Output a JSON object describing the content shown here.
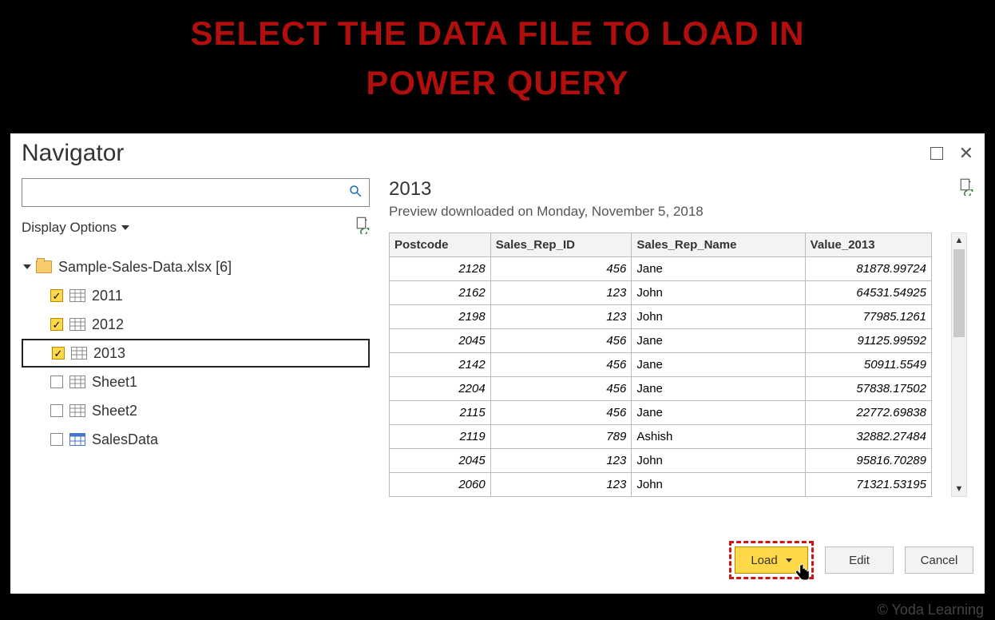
{
  "banner_line1": "SELECT THE DATA FILE TO LOAD IN",
  "banner_line2": "POWER QUERY",
  "copyright": "© Yoda Learning",
  "dialog": {
    "title": "Navigator",
    "search_placeholder": "",
    "display_options_label": "Display Options"
  },
  "tree": {
    "root_label": "Sample-Sales-Data.xlsx [6]",
    "items": [
      {
        "label": "2011",
        "checked": true,
        "selected": false,
        "icon": "sheet"
      },
      {
        "label": "2012",
        "checked": true,
        "selected": false,
        "icon": "sheet"
      },
      {
        "label": "2013",
        "checked": true,
        "selected": true,
        "icon": "sheet"
      },
      {
        "label": "Sheet1",
        "checked": false,
        "selected": false,
        "icon": "sheet"
      },
      {
        "label": "Sheet2",
        "checked": false,
        "selected": false,
        "icon": "sheet"
      },
      {
        "label": "SalesData",
        "checked": false,
        "selected": false,
        "icon": "table"
      }
    ]
  },
  "preview": {
    "title": "2013",
    "subtitle": "Preview downloaded on Monday, November 5, 2018",
    "columns": [
      "Postcode",
      "Sales_Rep_ID",
      "Sales_Rep_Name",
      "Value_2013"
    ],
    "rows": [
      [
        "2128",
        "456",
        "Jane",
        "81878.99724"
      ],
      [
        "2162",
        "123",
        "John",
        "64531.54925"
      ],
      [
        "2198",
        "123",
        "John",
        "77985.1261"
      ],
      [
        "2045",
        "456",
        "Jane",
        "91125.99592"
      ],
      [
        "2142",
        "456",
        "Jane",
        "50911.5549"
      ],
      [
        "2204",
        "456",
        "Jane",
        "57838.17502"
      ],
      [
        "2115",
        "456",
        "Jane",
        "22772.69838"
      ],
      [
        "2119",
        "789",
        "Ashish",
        "32882.27484"
      ],
      [
        "2045",
        "123",
        "John",
        "95816.70289"
      ],
      [
        "2060",
        "123",
        "John",
        "71321.53195"
      ]
    ],
    "col_align": [
      "num",
      "num",
      "txt",
      "num"
    ]
  },
  "buttons": {
    "load": "Load",
    "edit": "Edit",
    "cancel": "Cancel"
  }
}
